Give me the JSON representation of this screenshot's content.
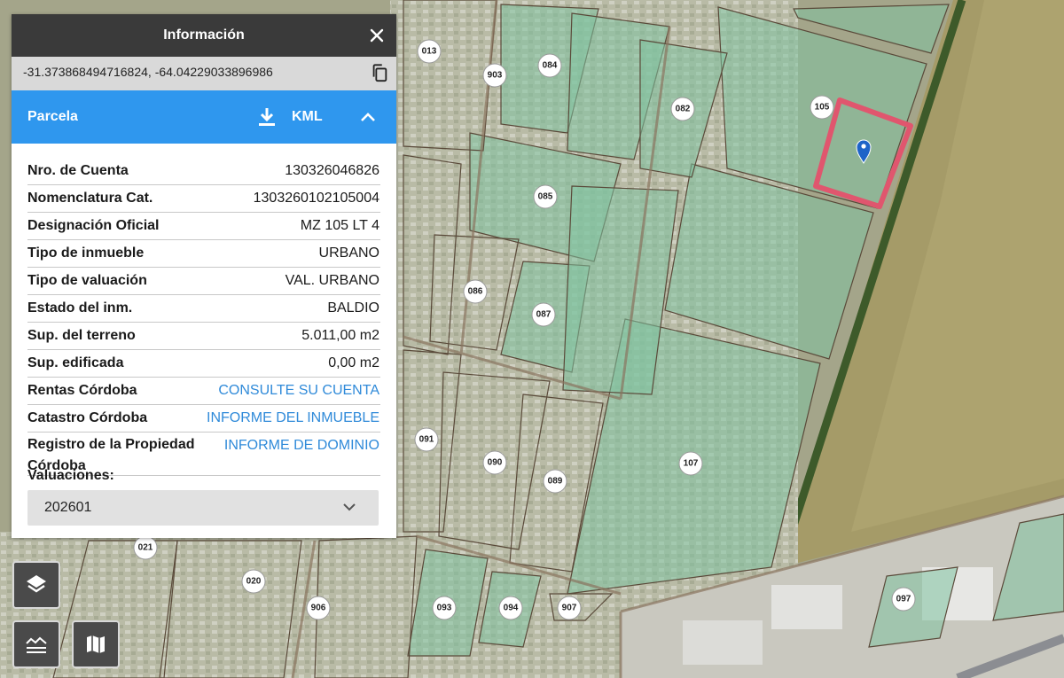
{
  "panel": {
    "title": "Información",
    "coordinates": "-31.373868494716824, -64.04229033896986",
    "section_title": "Parcela",
    "kml_label": "KML",
    "rows": [
      {
        "label": "Nro. de Cuenta",
        "value": "130326046826"
      },
      {
        "label": "Nomenclatura Cat.",
        "value": "1303260102105004"
      },
      {
        "label": "Designación Oficial",
        "value": "MZ 105 LT 4"
      },
      {
        "label": "Tipo de inmueble",
        "value": "URBANO"
      },
      {
        "label": "Tipo de valuación",
        "value": "VAL. URBANO"
      },
      {
        "label": "Estado del inm.",
        "value": "BALDIO"
      },
      {
        "label": "Sup. del terreno",
        "value": "5.011,00 m2"
      },
      {
        "label": "Sup. edificada",
        "value": "0,00 m2"
      },
      {
        "label": "Rentas Córdoba",
        "value": "CONSULTE SU CUENTA"
      },
      {
        "label": "Catastro Córdoba",
        "value": "INFORME DEL INMUEBLE"
      },
      {
        "label_line1": "Registro de la Propiedad",
        "label_line2": "Córdoba",
        "value": "INFORME DE DOMINIO"
      }
    ],
    "valuations_label": "Valuaciones:",
    "valuations_selected": "202601"
  },
  "map": {
    "block_labels": [
      "013",
      "903",
      "084",
      "082",
      "105",
      "085",
      "086",
      "087",
      "091",
      "090",
      "089",
      "107",
      "021",
      "020",
      "906",
      "093",
      "094",
      "907",
      "097"
    ],
    "icons": [
      "location-pin-icon"
    ],
    "selected_parcel_color": "#e0566e"
  },
  "controls": {
    "icons": [
      "layers-icon",
      "terrain-icon",
      "map-icon"
    ]
  },
  "colors": {
    "header": "#3a3a3a",
    "accent": "#2f97ee",
    "link": "#2f8ad9",
    "parcel_fill": "#7fc3a0"
  }
}
